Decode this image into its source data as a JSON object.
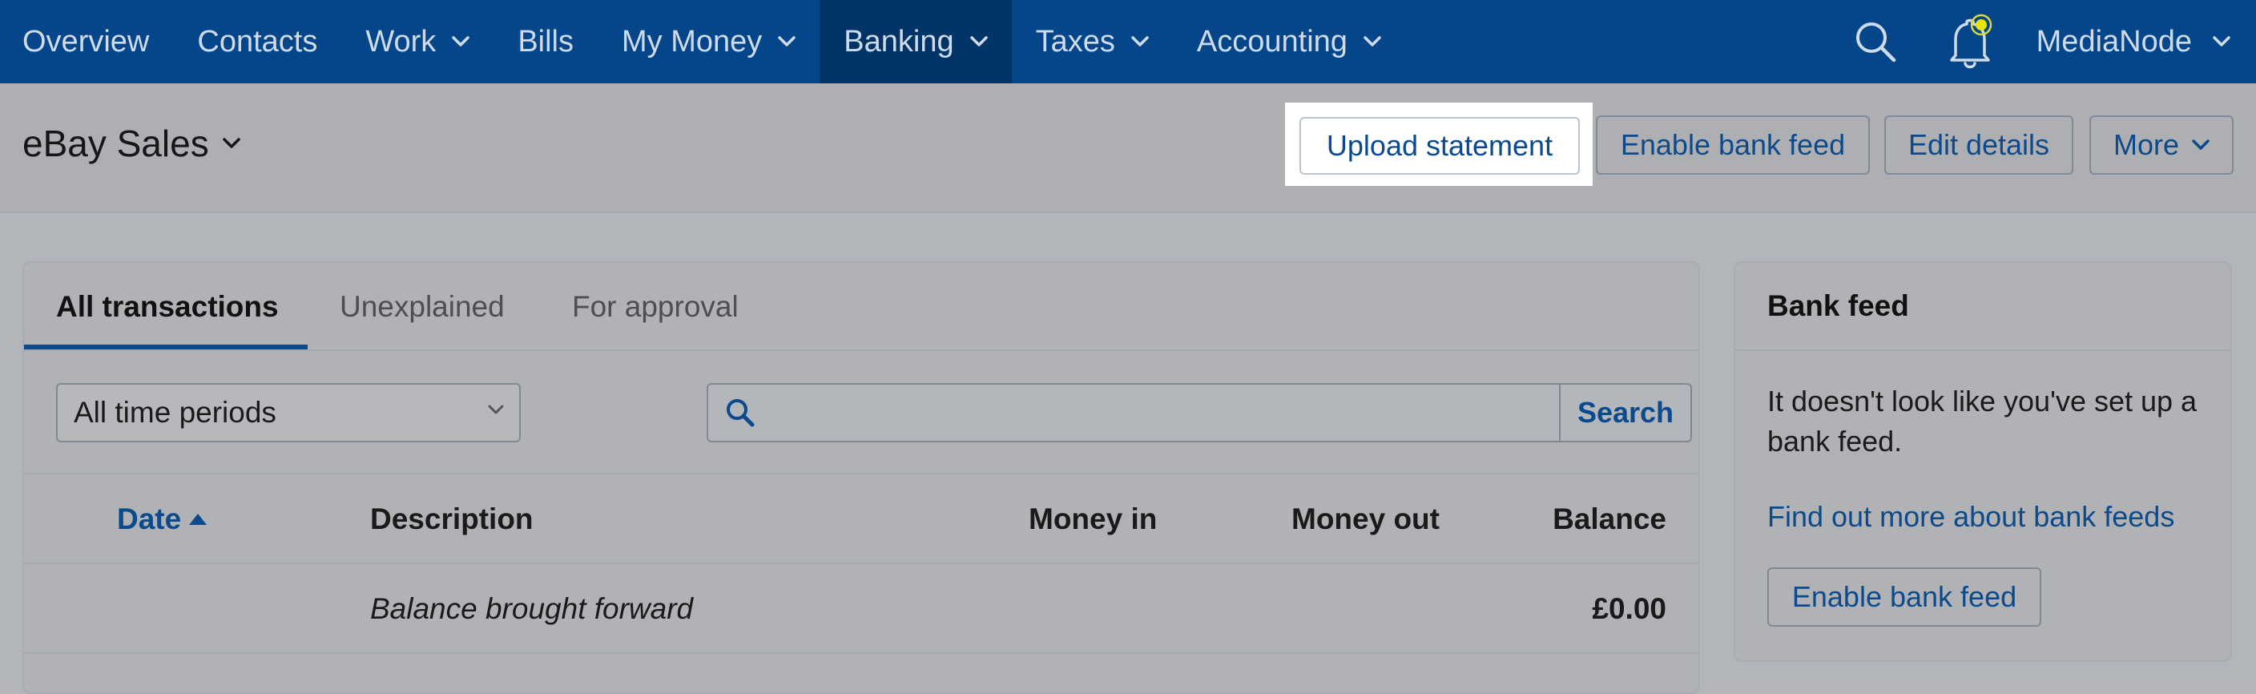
{
  "nav": {
    "items": [
      {
        "label": "Overview",
        "dropdown": false,
        "active": false
      },
      {
        "label": "Contacts",
        "dropdown": false,
        "active": false
      },
      {
        "label": "Work",
        "dropdown": true,
        "active": false
      },
      {
        "label": "Bills",
        "dropdown": false,
        "active": false
      },
      {
        "label": "My Money",
        "dropdown": true,
        "active": false
      },
      {
        "label": "Banking",
        "dropdown": true,
        "active": true
      },
      {
        "label": "Taxes",
        "dropdown": true,
        "active": false
      },
      {
        "label": "Accounting",
        "dropdown": true,
        "active": false
      }
    ],
    "user": "MediaNode",
    "icons": {
      "search": "search-icon",
      "bell": "bell-icon",
      "notification_dot_color": "#e6e600"
    }
  },
  "header": {
    "account_title": "eBay Sales",
    "buttons": {
      "upload": "Upload statement",
      "enable": "Enable bank feed",
      "edit": "Edit details",
      "more": "More"
    }
  },
  "transactions": {
    "tabs": [
      "All transactions",
      "Unexplained",
      "For approval"
    ],
    "active_tab": "All transactions",
    "period_select": "All time periods",
    "search": {
      "placeholder": "",
      "button": "Search"
    },
    "columns": {
      "date": "Date",
      "description": "Description",
      "money_in": "Money in",
      "money_out": "Money out",
      "balance": "Balance"
    },
    "rows": [
      {
        "date": "",
        "description": "Balance brought forward",
        "money_in": "",
        "money_out": "",
        "balance": "£0.00"
      }
    ]
  },
  "bank_feed": {
    "title": "Bank feed",
    "text": "It doesn't look like you've set up a bank feed.",
    "link": "Find out more about bank feeds",
    "button": "Enable bank feed"
  },
  "colors": {
    "nav_bg": "#05468b",
    "nav_active_bg": "#033468",
    "accent": "#0b4a8c",
    "overlay_bg": "#b0b2b5"
  }
}
